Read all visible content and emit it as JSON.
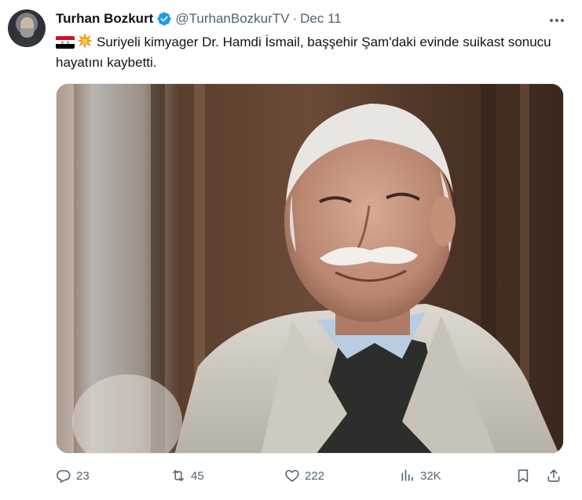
{
  "tweet": {
    "author_name": "Turhan Bozkurt",
    "handle": "@TurhanBozkurTV",
    "separator": "·",
    "date": "Dec 11",
    "text": "Suriyeli kimyager Dr. Hamdi İsmail, başşehir Şam'daki evinde suikast sonucu hayatını kaybetti.",
    "emojis": [
      "syria-flag",
      "collision"
    ]
  },
  "colors": {
    "verified_badge": "#1d9bf0",
    "secondary_text": "#536471",
    "primary_text": "#0f1419"
  },
  "actions": {
    "replies": "23",
    "reposts": "45",
    "likes": "222",
    "views": "32K"
  },
  "icons": {
    "reply": "reply-icon",
    "repost": "repost-icon",
    "like": "heart-icon",
    "views": "views-chart-icon",
    "bookmark": "bookmark-icon",
    "share": "share-icon",
    "more": "more-icon",
    "verified": "verified-badge-icon"
  }
}
